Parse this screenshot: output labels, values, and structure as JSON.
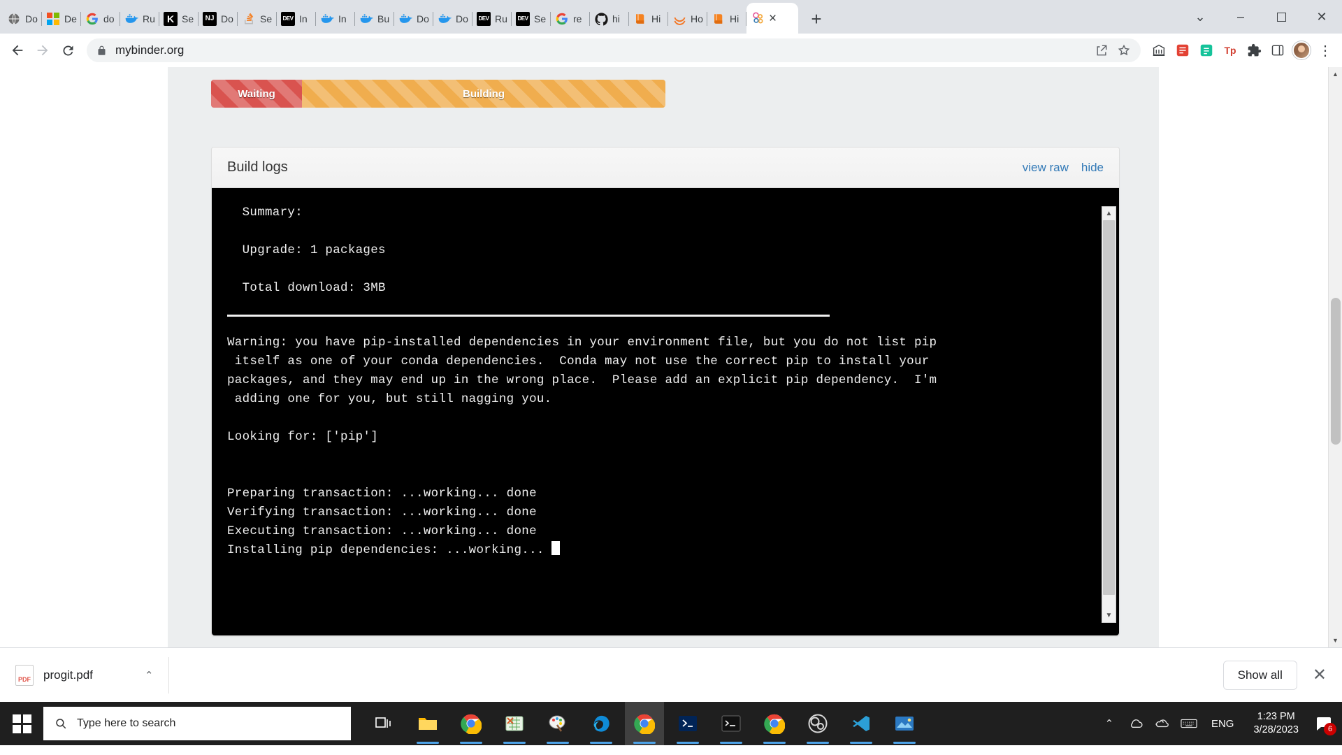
{
  "browser": {
    "tabs": [
      {
        "title": "Do",
        "favicon": "globe-icon",
        "active": false
      },
      {
        "title": "De",
        "favicon": "microsoft-icon",
        "active": false
      },
      {
        "title": "do",
        "favicon": "google-icon",
        "active": false
      },
      {
        "title": "Ru",
        "favicon": "docker-icon",
        "active": false
      },
      {
        "title": "Se",
        "favicon": "kaggle-icon",
        "active": false
      },
      {
        "title": "Do",
        "favicon": "nj-icon",
        "active": false
      },
      {
        "title": "Se",
        "favicon": "stackoverflow-icon",
        "active": false
      },
      {
        "title": "In",
        "favicon": "dev-icon",
        "active": false
      },
      {
        "title": "In",
        "favicon": "docker-icon",
        "active": false
      },
      {
        "title": "Bu",
        "favicon": "docker-icon",
        "active": false
      },
      {
        "title": "Do",
        "favicon": "docker-icon",
        "active": false
      },
      {
        "title": "Do",
        "favicon": "docker-icon",
        "active": false
      },
      {
        "title": "Ru",
        "favicon": "dev-icon",
        "active": false
      },
      {
        "title": "Se",
        "favicon": "dev-icon",
        "active": false
      },
      {
        "title": "re",
        "favicon": "google-icon",
        "active": false
      },
      {
        "title": "hi",
        "favicon": "github-icon",
        "active": false
      },
      {
        "title": "Hi",
        "favicon": "book-icon",
        "active": false
      },
      {
        "title": "Ho",
        "favicon": "jupyter-icon",
        "active": false
      },
      {
        "title": "Hi",
        "favicon": "book-icon",
        "active": false
      },
      {
        "title": "",
        "favicon": "binder-icon",
        "active": true
      }
    ],
    "new_tab_label": "+",
    "close_tab_label": "×",
    "window_controls": {
      "minimize": "–",
      "maximize": "–",
      "close": "✕",
      "chevron": "⌄"
    },
    "toolbar": {
      "back_label": "←",
      "forward_label": "→",
      "reload_label": "⟳",
      "url": "mybinder.org",
      "lock_icon": "lock-icon",
      "share_icon": "share-icon",
      "bookmark_icon": "star-icon",
      "extensions": [
        "bank-icon",
        "red-book-icon",
        "grammarly-icon",
        "tp-icon",
        "puzzle-icon",
        "sidepanel-icon"
      ],
      "menu_label": "⋮"
    }
  },
  "page": {
    "progress": {
      "waiting_label": "Waiting",
      "building_label": "Building",
      "waiting_color": "#d9534f",
      "building_color": "#f0ad4e"
    },
    "logs_panel": {
      "title": "Build logs",
      "view_raw_label": "view raw",
      "hide_label": "hide",
      "lines": [
        "  Summary:",
        "",
        "  Upgrade: 1 packages",
        "",
        "  Total download: 3MB",
        ""
      ],
      "warning_lines": [
        "Warning: you have pip-installed dependencies in your environment file, but you do not list pip",
        " itself as one of your conda dependencies.  Conda may not use the correct pip to install your",
        "packages, and they may end up in the wrong place.  Please add an explicit pip dependency.  I'm",
        " adding one for you, but still nagging you."
      ],
      "tail_lines": [
        "Looking for: ['pip']",
        "",
        "",
        "Preparing transaction: ...working... done",
        "Verifying transaction: ...working... done",
        "Executing transaction: ...working... done",
        "Installing pip dependencies: ...working... "
      ]
    }
  },
  "download_shelf": {
    "file_name": "progit.pdf",
    "file_type_label": "PDF",
    "caret_label": "⌃",
    "show_all_label": "Show all",
    "close_label": "✕"
  },
  "taskbar": {
    "search_placeholder": "Type here to search",
    "search_icon": "search-icon",
    "start_icon": "windows-start-icon",
    "apps": [
      {
        "name": "task-view-icon"
      },
      {
        "name": "file-explorer-icon"
      },
      {
        "name": "chrome-icon"
      },
      {
        "name": "excel-icon"
      },
      {
        "name": "paint-icon"
      },
      {
        "name": "edge-icon"
      },
      {
        "name": "chrome-active-icon"
      },
      {
        "name": "powershell-icon"
      },
      {
        "name": "terminal-icon"
      },
      {
        "name": "chrome-2-icon"
      },
      {
        "name": "obs-icon"
      },
      {
        "name": "vscode-icon"
      },
      {
        "name": "photos-icon"
      }
    ],
    "tray": {
      "chevron_up": "⌃",
      "cloud_icon": "cloud-icon",
      "onedrive_icon": "onedrive-icon",
      "keyboard_icon": "keyboard-icon",
      "language": "ENG",
      "time": "1:23 PM",
      "date": "3/28/2023",
      "notification_count": "6"
    }
  }
}
